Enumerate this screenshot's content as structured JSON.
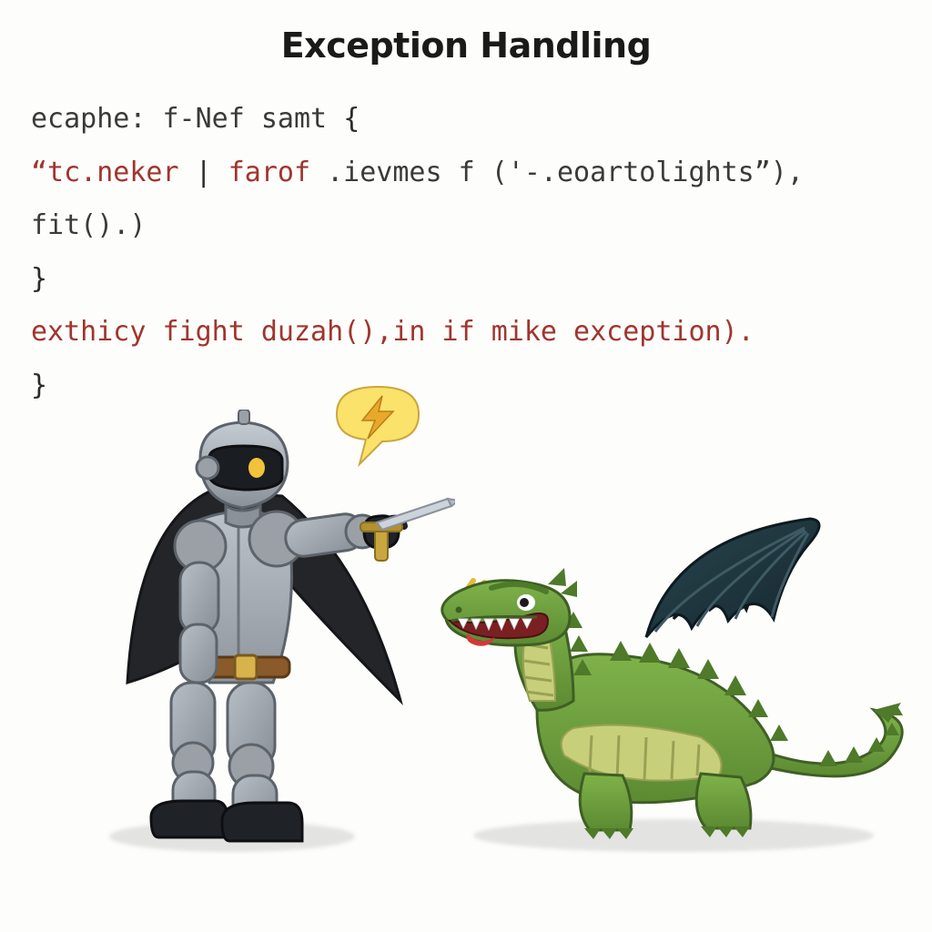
{
  "title": "Exception Handling",
  "code": {
    "line1": {
      "a": "ecaphe:",
      "b": "f-Nef",
      "c": "samt",
      "d": "{"
    },
    "line2": {
      "a": "“tc.neker",
      "b": "|",
      "c": "farof",
      "d": ".ievmes",
      "e": "f ('-.eoartolights”),",
      "f": "fit().)"
    },
    "line3": {
      "a": "}"
    },
    "line4": {
      "a": "exthicy",
      "b": "fight duzah(),in",
      "c": "if",
      "d": "mike exception)."
    },
    "line5": {
      "a": "}"
    }
  },
  "colors": {
    "knight_armor": "#9aa0a6",
    "knight_armor_dark": "#6f757c",
    "cape": "#202226",
    "belt": "#8a5a2a",
    "dragon_body": "#6f9f3f",
    "dragon_dark": "#4e7a2a",
    "dragon_wing": "#1f323a",
    "dragon_tongue": "#d2383a",
    "dragon_belly": "#c7cf7a",
    "bubble": "#fbe26a",
    "bolt": "#e8a82a",
    "spark": "#e8b83a"
  },
  "icons": {
    "knight": "knight-icon",
    "dragon": "dragon-icon",
    "bubble": "speech-bubble-icon",
    "bolt": "lightning-bolt-icon",
    "spark": "spark-icon",
    "shadow": "shadow-icon"
  }
}
